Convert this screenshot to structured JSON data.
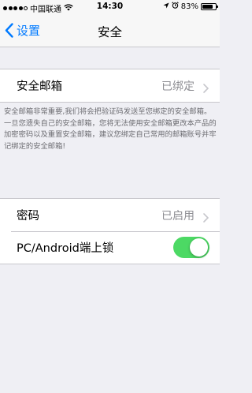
{
  "status_bar": {
    "carrier": "中国联通",
    "time": "14:30",
    "battery": "83%",
    "battery_level": 0.83
  },
  "nav": {
    "back_label": "设置",
    "title": "安全"
  },
  "email_row": {
    "label": "安全邮箱",
    "value": "已绑定"
  },
  "footnote": "安全邮箱非常重要,我们将会把验证码发送至您绑定的安全邮箱。一旦您遗失自己的安全邮箱，您将无法使用安全邮箱更改本产品的加密密码以及重置安全邮箱，建议您绑定自己常用的邮箱账号并牢记绑定的安全邮箱!",
  "password_row": {
    "label": "密码",
    "value": "已启用"
  },
  "lock_row": {
    "label": "PC/Android端上锁",
    "enabled": true
  },
  "colors": {
    "accent": "#007aff",
    "toggle_on": "#4cd964",
    "background": "#efeff4"
  }
}
